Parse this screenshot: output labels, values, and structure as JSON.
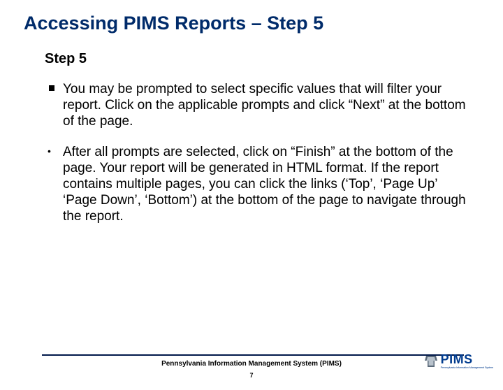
{
  "title": "Accessing PIMS Reports – Step 5",
  "subtitle": "Step 5",
  "bullets": [
    {
      "style": "square",
      "text": "You may be prompted to select specific values that will filter your report.  Click on the applicable prompts and click “Next” at the bottom of the page."
    },
    {
      "style": "dot",
      "text": "After all prompts are selected, click on “Finish” at the bottom of the page.   Your report will be generated in HTML format.  If the report contains multiple pages, you can click the links (‘Top’, ‘Page Up’ ‘Page Down’, ‘Bottom’) at the bottom of the page to navigate through the report."
    }
  ],
  "footer": {
    "org": "Pennsylvania Information Management System (PIMS)",
    "page": "7"
  },
  "logo": {
    "text": "PIMS",
    "sub": "Pennsylvania Information Management System"
  }
}
